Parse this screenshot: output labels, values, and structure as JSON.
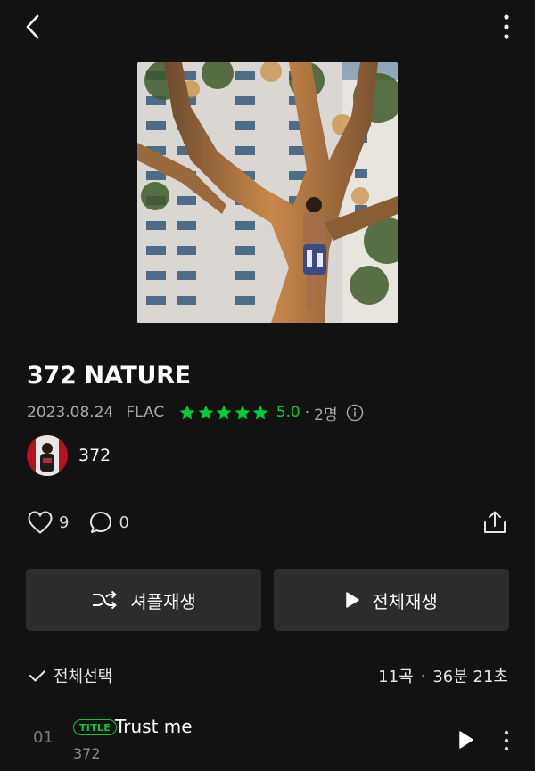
{
  "album": {
    "title": "372 NATURE",
    "release_date": "2023.08.24",
    "format": "FLAC",
    "rating": {
      "stars": 5,
      "value": "5.0",
      "count": "2명"
    },
    "cover_icon": "album-cover"
  },
  "artist": {
    "name": "372"
  },
  "social": {
    "likes": "9",
    "comments": "0"
  },
  "buttons": {
    "shuffle_label": "셔플재생",
    "play_all_label": "전체재생"
  },
  "tracklist": {
    "select_all_label": "전체선택",
    "track_count": "11곡",
    "total_duration": "36분 21초",
    "tracks": [
      {
        "number": "01",
        "badge": "TITLE",
        "title": "Trust me",
        "artist": "372"
      }
    ]
  },
  "colors": {
    "background": "#121212",
    "accent_green": "#00cd3c",
    "button_bg": "#2c2c2c",
    "secondary_text": "#a8a8a8"
  }
}
